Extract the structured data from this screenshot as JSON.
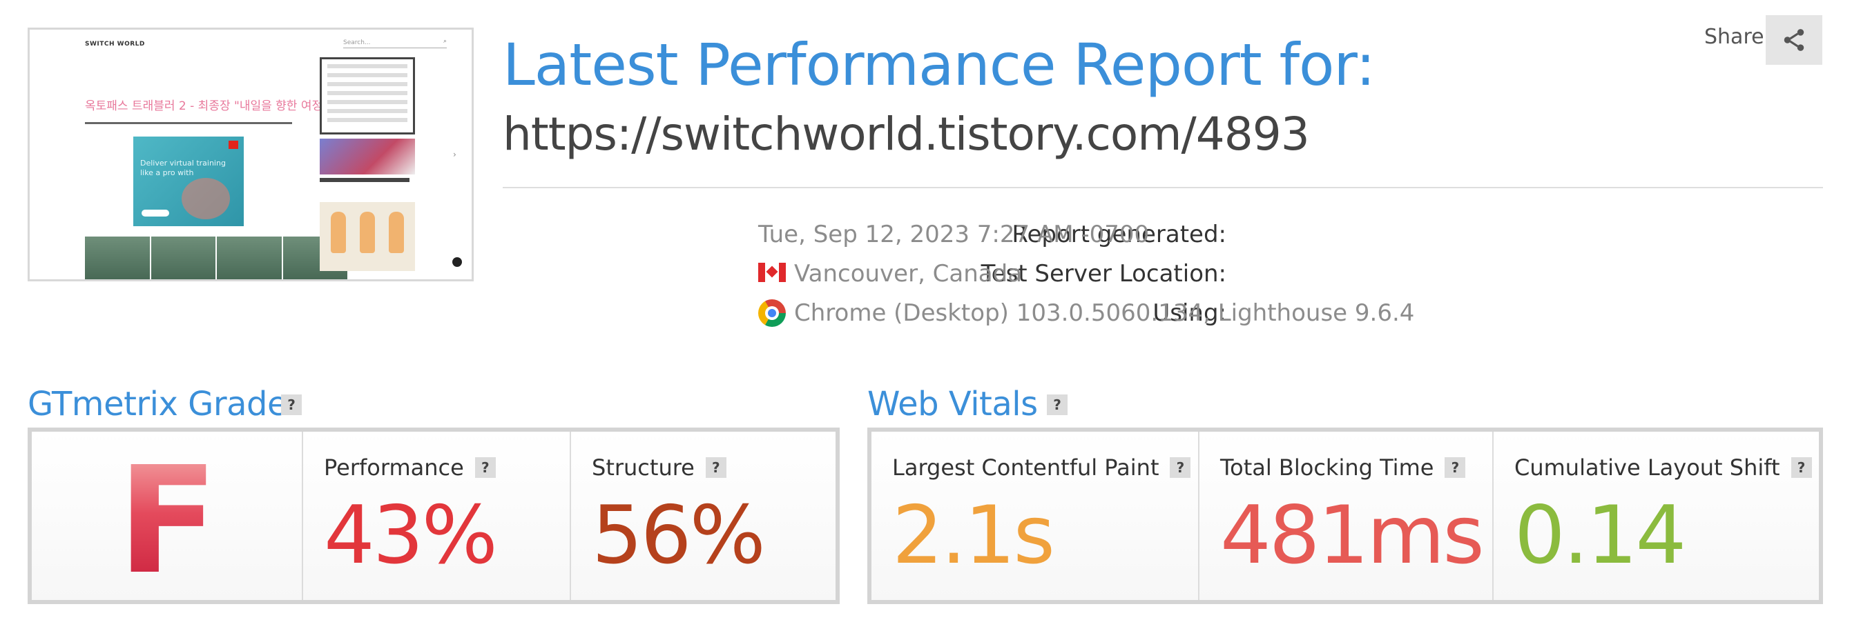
{
  "header": {
    "title": "Latest Performance Report for:",
    "url": "https://switchworld.tistory.com/4893",
    "share_label": "Share"
  },
  "thumbnail": {
    "site_name": "SWITCH WORLD",
    "search_placeholder": "Search...",
    "post_title": "옥토패스 트래블러 2 - 최종장 \"내일을 향한 여정\"",
    "ad_text": "Deliver virtual training like a pro with"
  },
  "report": {
    "generated_label": "Report generated:",
    "generated_value": "Tue, Sep 12, 2023 7:27 AM -0700",
    "location_label": "Test Server Location:",
    "location_value": "Vancouver, Canada",
    "using_label": "Using:",
    "using_value": "Chrome (Desktop) 103.0.5060.134, Lighthouse 9.6.4"
  },
  "grade_section": {
    "title": "GTmetrix Grade",
    "help": "?",
    "grade": "F",
    "performance_label": "Performance",
    "performance_value": "43%",
    "structure_label": "Structure",
    "structure_value": "56%"
  },
  "vitals_section": {
    "title": "Web Vitals",
    "help": "?",
    "lcp_label": "Largest Contentful Paint",
    "lcp_value": "2.1s",
    "tbt_label": "Total Blocking Time",
    "tbt_value": "481ms",
    "cls_label": "Cumulative Layout Shift",
    "cls_value": "0.14"
  },
  "colors": {
    "accent_blue": "#3b8fd9",
    "grade_f": "#d42a46",
    "performance": "#e2363b",
    "structure": "#b5411c",
    "lcp": "#f0a13c",
    "tbt": "#e65a55",
    "cls": "#8bbb3e"
  },
  "icons": {
    "share": "share-icon",
    "flag": "canada-flag-icon",
    "browser": "chrome-icon",
    "help": "help-icon"
  }
}
